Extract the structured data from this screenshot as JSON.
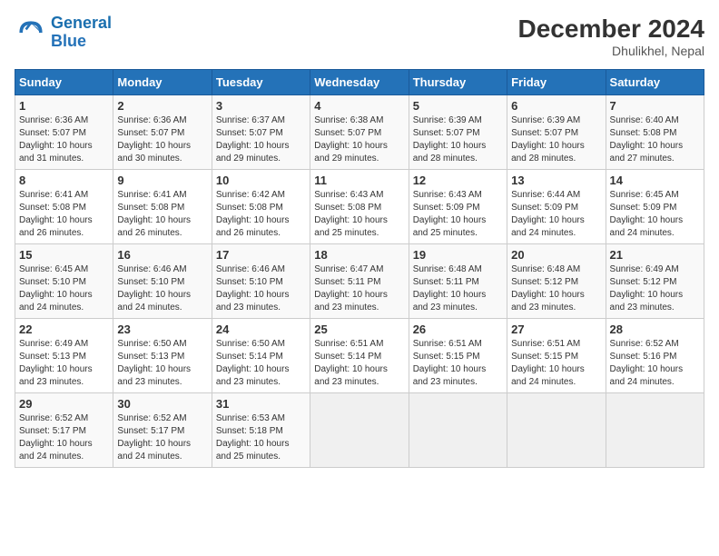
{
  "logo": {
    "line1": "General",
    "line2": "Blue"
  },
  "title": "December 2024",
  "location": "Dhulikhel, Nepal",
  "days_of_week": [
    "Sunday",
    "Monday",
    "Tuesday",
    "Wednesday",
    "Thursday",
    "Friday",
    "Saturday"
  ],
  "weeks": [
    [
      {
        "day": "1",
        "info": "Sunrise: 6:36 AM\nSunset: 5:07 PM\nDaylight: 10 hours\nand 31 minutes."
      },
      {
        "day": "2",
        "info": "Sunrise: 6:36 AM\nSunset: 5:07 PM\nDaylight: 10 hours\nand 30 minutes."
      },
      {
        "day": "3",
        "info": "Sunrise: 6:37 AM\nSunset: 5:07 PM\nDaylight: 10 hours\nand 29 minutes."
      },
      {
        "day": "4",
        "info": "Sunrise: 6:38 AM\nSunset: 5:07 PM\nDaylight: 10 hours\nand 29 minutes."
      },
      {
        "day": "5",
        "info": "Sunrise: 6:39 AM\nSunset: 5:07 PM\nDaylight: 10 hours\nand 28 minutes."
      },
      {
        "day": "6",
        "info": "Sunrise: 6:39 AM\nSunset: 5:07 PM\nDaylight: 10 hours\nand 28 minutes."
      },
      {
        "day": "7",
        "info": "Sunrise: 6:40 AM\nSunset: 5:08 PM\nDaylight: 10 hours\nand 27 minutes."
      }
    ],
    [
      {
        "day": "8",
        "info": "Sunrise: 6:41 AM\nSunset: 5:08 PM\nDaylight: 10 hours\nand 26 minutes."
      },
      {
        "day": "9",
        "info": "Sunrise: 6:41 AM\nSunset: 5:08 PM\nDaylight: 10 hours\nand 26 minutes."
      },
      {
        "day": "10",
        "info": "Sunrise: 6:42 AM\nSunset: 5:08 PM\nDaylight: 10 hours\nand 26 minutes."
      },
      {
        "day": "11",
        "info": "Sunrise: 6:43 AM\nSunset: 5:08 PM\nDaylight: 10 hours\nand 25 minutes."
      },
      {
        "day": "12",
        "info": "Sunrise: 6:43 AM\nSunset: 5:09 PM\nDaylight: 10 hours\nand 25 minutes."
      },
      {
        "day": "13",
        "info": "Sunrise: 6:44 AM\nSunset: 5:09 PM\nDaylight: 10 hours\nand 24 minutes."
      },
      {
        "day": "14",
        "info": "Sunrise: 6:45 AM\nSunset: 5:09 PM\nDaylight: 10 hours\nand 24 minutes."
      }
    ],
    [
      {
        "day": "15",
        "info": "Sunrise: 6:45 AM\nSunset: 5:10 PM\nDaylight: 10 hours\nand 24 minutes."
      },
      {
        "day": "16",
        "info": "Sunrise: 6:46 AM\nSunset: 5:10 PM\nDaylight: 10 hours\nand 24 minutes."
      },
      {
        "day": "17",
        "info": "Sunrise: 6:46 AM\nSunset: 5:10 PM\nDaylight: 10 hours\nand 23 minutes."
      },
      {
        "day": "18",
        "info": "Sunrise: 6:47 AM\nSunset: 5:11 PM\nDaylight: 10 hours\nand 23 minutes."
      },
      {
        "day": "19",
        "info": "Sunrise: 6:48 AM\nSunset: 5:11 PM\nDaylight: 10 hours\nand 23 minutes."
      },
      {
        "day": "20",
        "info": "Sunrise: 6:48 AM\nSunset: 5:12 PM\nDaylight: 10 hours\nand 23 minutes."
      },
      {
        "day": "21",
        "info": "Sunrise: 6:49 AM\nSunset: 5:12 PM\nDaylight: 10 hours\nand 23 minutes."
      }
    ],
    [
      {
        "day": "22",
        "info": "Sunrise: 6:49 AM\nSunset: 5:13 PM\nDaylight: 10 hours\nand 23 minutes."
      },
      {
        "day": "23",
        "info": "Sunrise: 6:50 AM\nSunset: 5:13 PM\nDaylight: 10 hours\nand 23 minutes."
      },
      {
        "day": "24",
        "info": "Sunrise: 6:50 AM\nSunset: 5:14 PM\nDaylight: 10 hours\nand 23 minutes."
      },
      {
        "day": "25",
        "info": "Sunrise: 6:51 AM\nSunset: 5:14 PM\nDaylight: 10 hours\nand 23 minutes."
      },
      {
        "day": "26",
        "info": "Sunrise: 6:51 AM\nSunset: 5:15 PM\nDaylight: 10 hours\nand 23 minutes."
      },
      {
        "day": "27",
        "info": "Sunrise: 6:51 AM\nSunset: 5:15 PM\nDaylight: 10 hours\nand 24 minutes."
      },
      {
        "day": "28",
        "info": "Sunrise: 6:52 AM\nSunset: 5:16 PM\nDaylight: 10 hours\nand 24 minutes."
      }
    ],
    [
      {
        "day": "29",
        "info": "Sunrise: 6:52 AM\nSunset: 5:17 PM\nDaylight: 10 hours\nand 24 minutes."
      },
      {
        "day": "30",
        "info": "Sunrise: 6:52 AM\nSunset: 5:17 PM\nDaylight: 10 hours\nand 24 minutes."
      },
      {
        "day": "31",
        "info": "Sunrise: 6:53 AM\nSunset: 5:18 PM\nDaylight: 10 hours\nand 25 minutes."
      },
      null,
      null,
      null,
      null
    ]
  ]
}
